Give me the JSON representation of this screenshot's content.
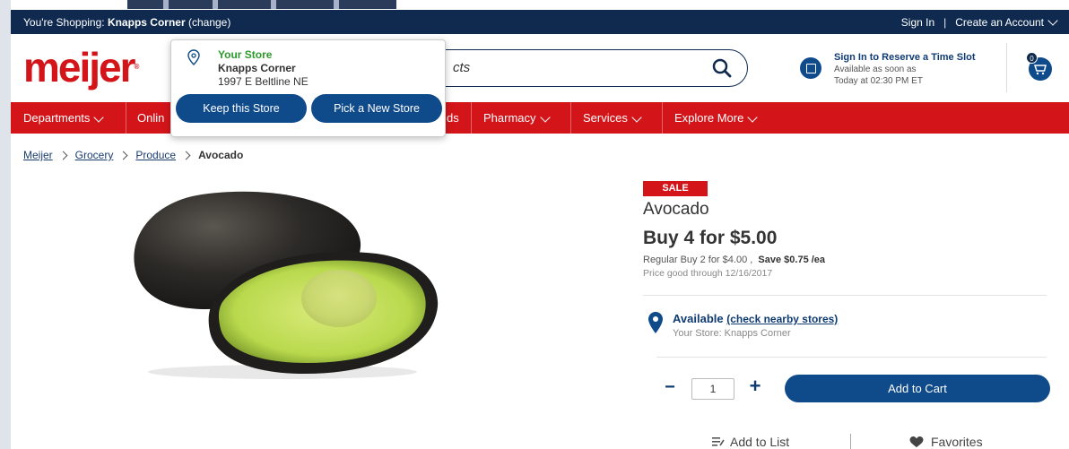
{
  "topbar": {
    "shopping_prefix": "You're Shopping:",
    "store": "Knapps Corner",
    "change": "(change)",
    "sign_in": "Sign In",
    "separator": "|",
    "create_account": "Create an Account"
  },
  "header": {
    "logo": "meijer",
    "search_placeholder_fragment": "cts",
    "reserve_title": "Sign In to Reserve a Time Slot",
    "reserve_line1": "Available as soon as",
    "reserve_line2": "Today at 02:30 PM ET",
    "cart_count": "0"
  },
  "nav": {
    "items": [
      "Departments",
      "Onlin",
      "ds",
      "Pharmacy",
      "Services",
      "Explore More"
    ]
  },
  "breadcrumb": {
    "items": [
      "Meijer",
      "Grocery",
      "Produce"
    ],
    "current": "Avocado"
  },
  "product": {
    "badge": "SALE",
    "name": "Avocado",
    "deal": "Buy 4 for $5.00",
    "regular_prefix": "Regular Buy 2 for $4.00 ,",
    "save": "Save $0.75 /ea",
    "price_good": "Price good through 12/16/2017",
    "availability": "Available",
    "check_stores": "(check nearby stores)",
    "your_store": "Your Store: Knapps Corner",
    "quantity": "1",
    "minus": "−",
    "plus": "+",
    "add_to_cart": "Add to Cart",
    "add_to_list": "Add to List",
    "favorites": "Favorites"
  },
  "store_popover": {
    "title": "Your Store",
    "store_name": "Knapps Corner",
    "address": "1997 E Beltline NE",
    "keep": "Keep this Store",
    "pick": "Pick a New Store"
  },
  "colors": {
    "brand_red": "#d3151a",
    "navy": "#0f2a4e",
    "button_blue": "#0f4a8a",
    "store_green": "#2c9b2c"
  }
}
